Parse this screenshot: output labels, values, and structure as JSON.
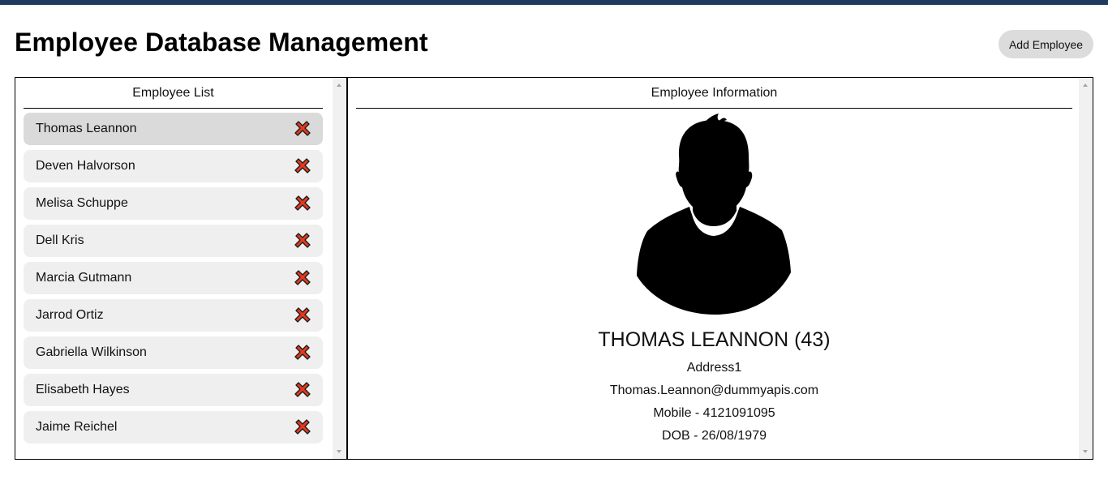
{
  "header": {
    "title": "Employee Database Management",
    "add_button_label": "Add Employee"
  },
  "list_panel": {
    "title": "Employee List",
    "employees": [
      {
        "name": "Thomas Leannon",
        "selected": true
      },
      {
        "name": "Deven Halvorson",
        "selected": false
      },
      {
        "name": "Melisa Schuppe",
        "selected": false
      },
      {
        "name": "Dell Kris",
        "selected": false
      },
      {
        "name": "Marcia Gutmann",
        "selected": false
      },
      {
        "name": "Jarrod Ortiz",
        "selected": false
      },
      {
        "name": "Gabriella Wilkinson",
        "selected": false
      },
      {
        "name": "Elisabeth Hayes",
        "selected": false
      },
      {
        "name": "Jaime Reichel",
        "selected": false
      }
    ],
    "delete_icon": "delete-x-icon"
  },
  "info_panel": {
    "title": "Employee Information",
    "avatar_icon": "person-silhouette-icon",
    "name_age": "THOMAS LEANNON (43)",
    "address": "Address1",
    "email": "Thomas.Leannon@dummyapis.com",
    "mobile": "Mobile - 4121091095",
    "dob": "DOB - 26/08/1979"
  },
  "colors": {
    "top_bar": "#1f3a5f",
    "item_bg": "#efefef",
    "item_selected_bg": "#dadada",
    "delete_icon": "#e23a1e",
    "button_bg": "#dcdcdc"
  }
}
